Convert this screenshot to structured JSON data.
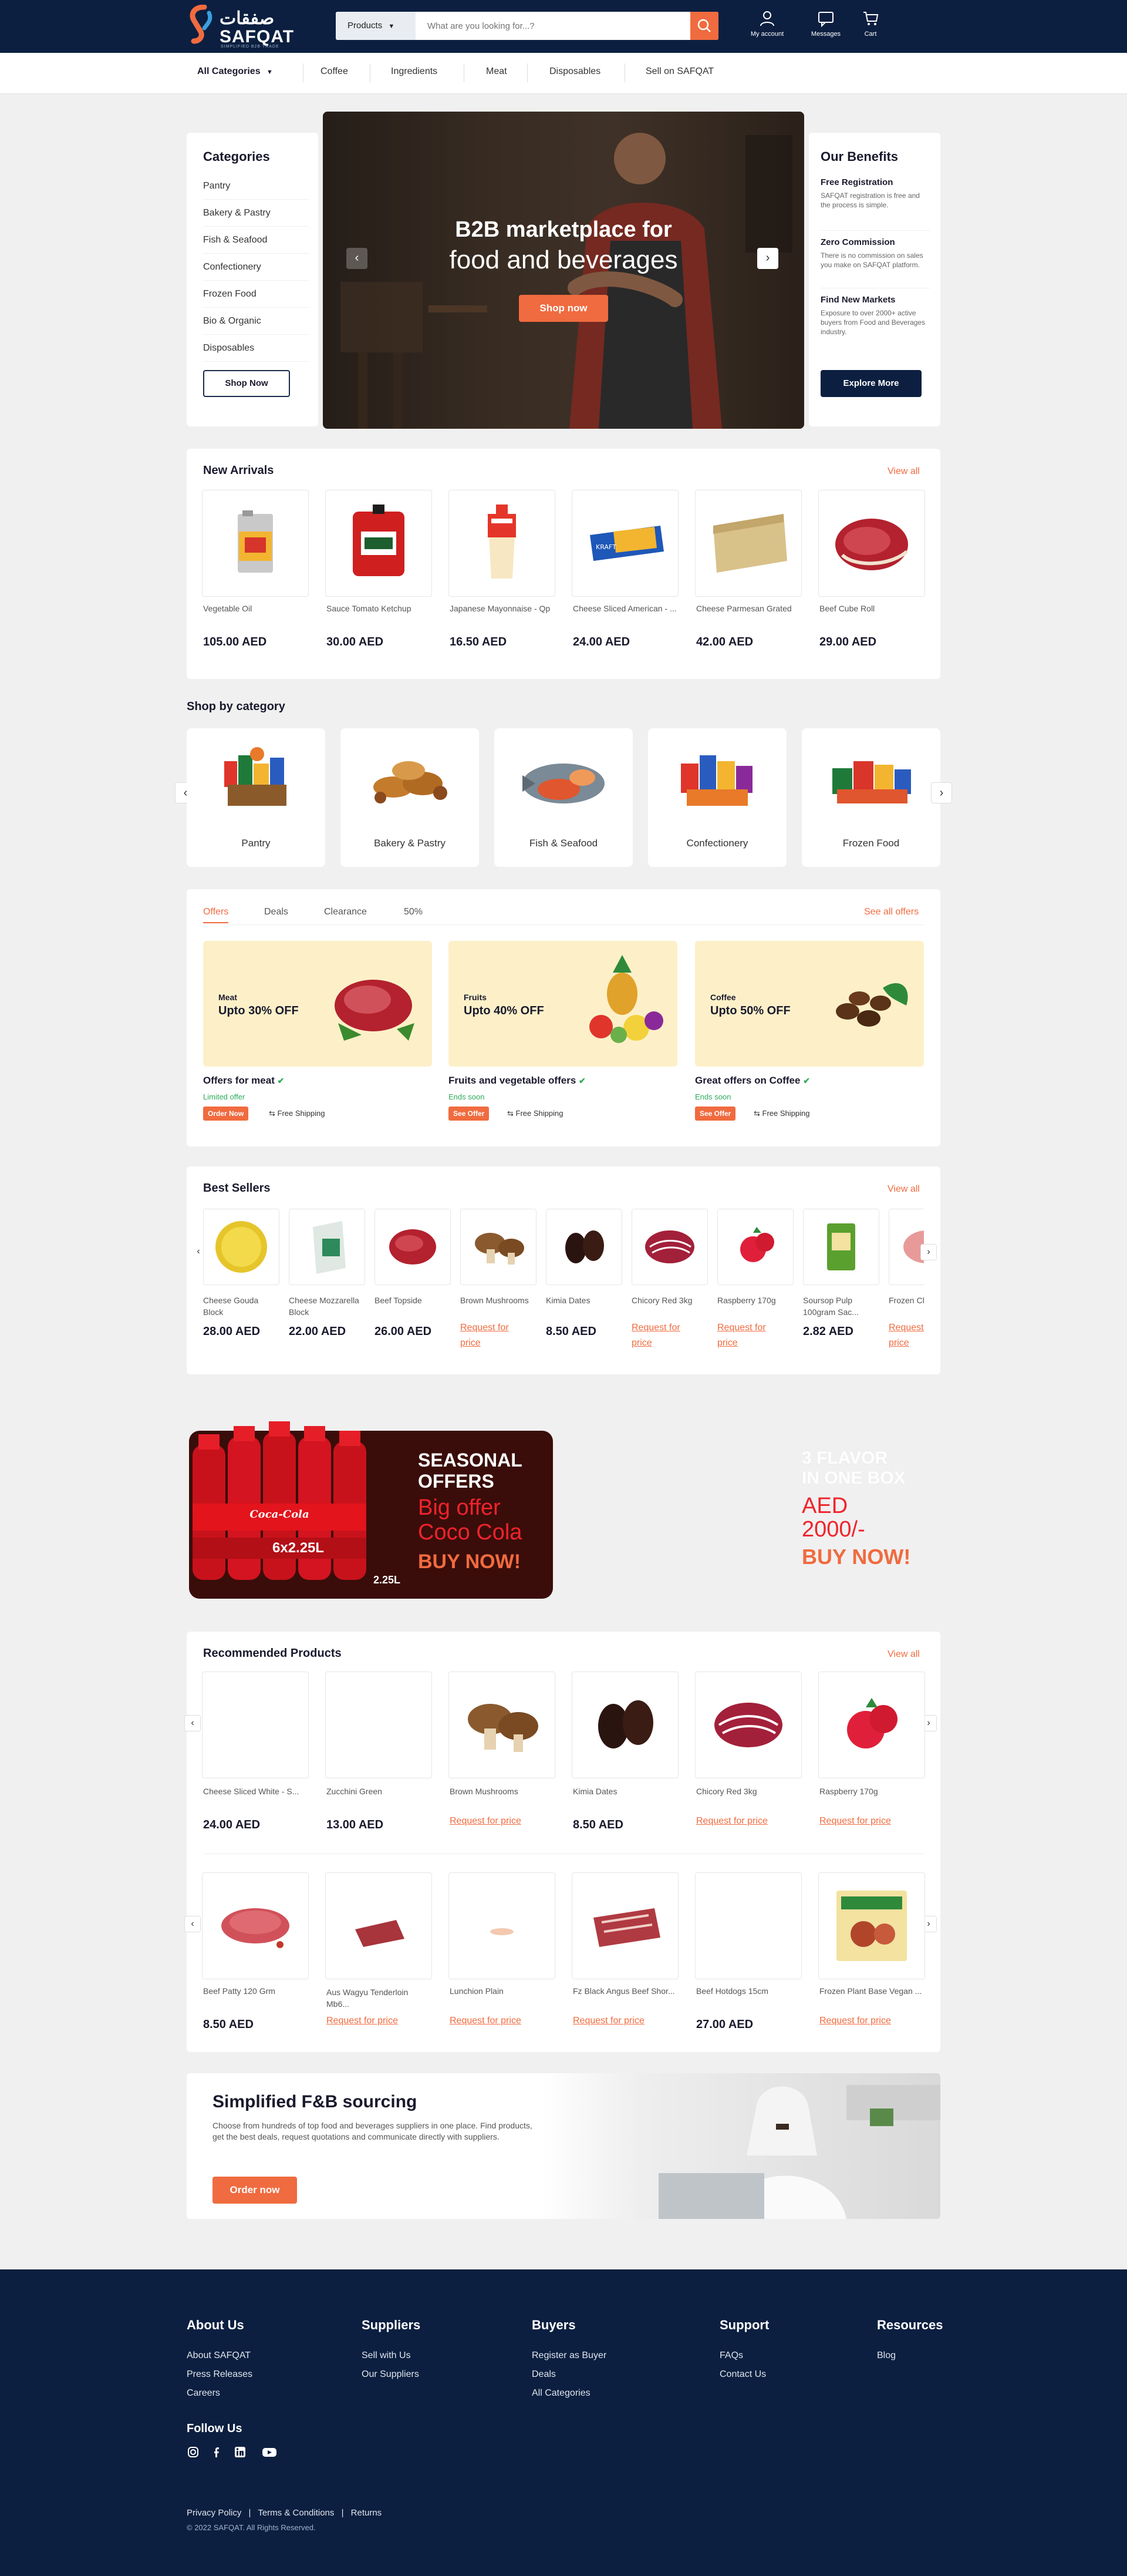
{
  "header": {
    "logo_ar": "صفقات",
    "logo_en": "SAFQAT",
    "logo_tagline": "SIMPLIFIED B2B TRADE",
    "search_category": "Products",
    "search_placeholder": "What are you looking for...?",
    "my_account": "My account",
    "messages": "Messages",
    "cart": "Cart"
  },
  "nav": {
    "all_categories": "All Categories",
    "items": [
      "Coffee",
      "Ingredients",
      "Meat",
      "Disposables",
      "Sell on SAFQAT"
    ]
  },
  "categories_panel": {
    "title": "Categories",
    "items": [
      "Pantry",
      "Bakery & Pastry",
      "Fish & Seafood",
      "Confectionery",
      "Frozen Food",
      "Bio & Organic",
      "Disposables"
    ],
    "button": "Shop Now"
  },
  "hero": {
    "title_line1": "B2B marketplace for",
    "title_line2": "food and beverages",
    "button": "Shop now"
  },
  "benefits": {
    "title": "Our Benefits",
    "items": [
      {
        "title": "Free Registration",
        "text": "SAFQAT registration is free and the process is simple."
      },
      {
        "title": "Zero Commission",
        "text": "There is no commission on sales you make on SAFQAT platform."
      },
      {
        "title": "Find New Markets",
        "text": "Exposure to over 2000+ active buyers from Food and Beverages industry."
      }
    ],
    "button": "Explore More"
  },
  "new_arrivals": {
    "title": "New Arrivals",
    "view_all": "View all",
    "items": [
      {
        "name": "Vegetable Oil",
        "price": "105.00 AED"
      },
      {
        "name": "Sauce Tomato Ketchup",
        "price": "30.00 AED"
      },
      {
        "name": "Japanese Mayonnaise - Qp",
        "price": "16.50 AED"
      },
      {
        "name": "Cheese Sliced American - ...",
        "price": "24.00 AED"
      },
      {
        "name": "Cheese Parmesan Grated",
        "price": "42.00 AED"
      },
      {
        "name": "Beef Cube Roll",
        "price": "29.00 AED"
      }
    ]
  },
  "shop_by_category": {
    "title": "Shop by category",
    "items": [
      "Pantry",
      "Bakery & Pastry",
      "Fish & Seafood",
      "Confectionery",
      "Frozen Food"
    ]
  },
  "offers": {
    "tabs": [
      "Offers",
      "Deals",
      "Clearance",
      "50%"
    ],
    "see_all": "See all offers",
    "cards": [
      {
        "tag": "Meat",
        "headline": "Upto 30% OFF",
        "title": "Offers for meat",
        "status": "Limited offer",
        "badge": "Order Now",
        "shipping": "Free Shipping"
      },
      {
        "tag": "Fruits",
        "headline": "Upto 40% OFF",
        "title": "Fruits and vegetable offers",
        "status": "Ends soon",
        "badge": "See Offer",
        "shipping": "Free Shipping"
      },
      {
        "tag": "Coffee",
        "headline": "Upto 50% OFF",
        "title": "Great offers on Coffee",
        "status": "Ends soon",
        "badge": "See Offer",
        "shipping": "Free Shipping"
      }
    ]
  },
  "best_sellers": {
    "title": "Best Sellers",
    "view_all": "View all",
    "items": [
      {
        "name": "Cheese Gouda Block",
        "price": "28.00 AED"
      },
      {
        "name": "Cheese Mozzarella Block",
        "price": "22.00 AED"
      },
      {
        "name": "Beef Topside",
        "price": "26.00 AED"
      },
      {
        "name": "Brown Mushrooms",
        "price": "Request for price"
      },
      {
        "name": "Kimia Dates",
        "price": "8.50 AED"
      },
      {
        "name": "Chicory Red 3kg",
        "price": "Request for price"
      },
      {
        "name": "Raspberry 170g",
        "price": "Request for price"
      },
      {
        "name": "Soursop Pulp 100gram Sac...",
        "price": "2.82 AED"
      },
      {
        "name": "Frozen Chicken...",
        "price": "Request for price"
      }
    ]
  },
  "promo": {
    "seasonal_line1": "SEASONAL",
    "seasonal_line2": "OFFERS",
    "big_offer_line1": "Big offer",
    "big_offer_line2": "Coco Cola",
    "buy_now": "BUY NOW!",
    "pack_label": "6x2.25L",
    "bottle_label": "2.25L",
    "bottle_brand": "Coca-Cola",
    "right_line1": "3 FLAVOR",
    "right_line2": "IN ONE BOX",
    "right_price_line1": "AED",
    "right_price_line2": "2000/-",
    "right_buy": "BUY NOW!"
  },
  "recommended": {
    "title": "Recommended Products",
    "view_all": "View all",
    "row1": [
      {
        "name": "Cheese Sliced White - S...",
        "price": "24.00 AED"
      },
      {
        "name": "Zucchini Green",
        "price": "13.00 AED"
      },
      {
        "name": "Brown Mushrooms",
        "price": "Request for price"
      },
      {
        "name": "Kimia Dates",
        "price": "8.50 AED"
      },
      {
        "name": "Chicory Red 3kg",
        "price": "Request for price"
      },
      {
        "name": "Raspberry 170g",
        "price": "Request for price"
      }
    ],
    "row2": [
      {
        "name": "Beef Patty 120 Grm",
        "price": "8.50 AED"
      },
      {
        "name": "Aus Wagyu Tenderloin Mb6...",
        "price": "Request for price"
      },
      {
        "name": "Lunchion Plain",
        "price": "Request for price"
      },
      {
        "name": "Fz Black Angus Beef Shor...",
        "price": "Request for price"
      },
      {
        "name": "Beef Hotdogs 15cm",
        "price": "27.00 AED"
      },
      {
        "name": "Frozen Plant Base Vegan ...",
        "price": "Request for price"
      }
    ]
  },
  "sourcing": {
    "title": "Simplified F&B sourcing",
    "text": "Choose from hundreds of top food and beverages suppliers in one place. Find products, get the best deals, request quotations and communicate directly with suppliers.",
    "button": "Order now"
  },
  "footer": {
    "columns": [
      {
        "title": "About Us",
        "links": [
          "About SAFQAT",
          "Press Releases",
          "Careers"
        ]
      },
      {
        "title": "Suppliers",
        "links": [
          "Sell with Us",
          "Our Suppliers"
        ]
      },
      {
        "title": "Buyers",
        "links": [
          "Register as Buyer",
          "Deals",
          "All Categories"
        ]
      },
      {
        "title": "Support",
        "links": [
          "FAQs",
          "Contact Us"
        ]
      },
      {
        "title": "Resources",
        "links": [
          "Blog"
        ]
      }
    ],
    "follow_us": "Follow Us",
    "legal": [
      "Privacy Policy",
      "Terms & Conditions",
      "Returns"
    ],
    "copyright": "© 2022 SAFQAT. All Rights Reserved."
  },
  "colors": {
    "navy": "#0c1f40",
    "orange": "#f06b3f",
    "cream": "#fdf0c8",
    "green": "#2eaa5a"
  }
}
